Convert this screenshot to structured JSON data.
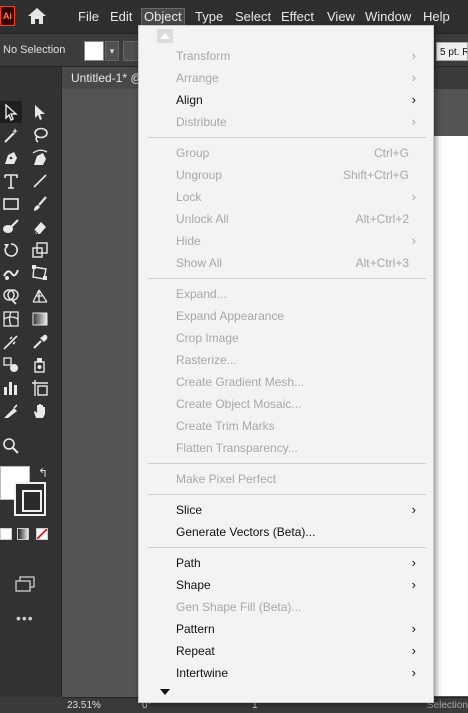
{
  "menubar": {
    "logo": "Ai",
    "items": [
      "File",
      "Edit",
      "Object",
      "Type",
      "Select",
      "Effect",
      "View",
      "Window",
      "Help"
    ]
  },
  "controlbar": {
    "selection_status": "No Selection",
    "stroke_weight": "5 pt. R"
  },
  "document": {
    "tab_title": "Untitled-1* @"
  },
  "statusbar": {
    "zoom": "23.51%",
    "rotation": "0°",
    "artboard": "1",
    "mode": "Selection"
  },
  "object_menu": {
    "items": [
      {
        "label": "Transform",
        "shortcut": "",
        "submenu": true,
        "enabled": false
      },
      {
        "label": "Arrange",
        "shortcut": "",
        "submenu": true,
        "enabled": false
      },
      {
        "label": "Align",
        "shortcut": "",
        "submenu": true,
        "enabled": true
      },
      {
        "label": "Distribute",
        "shortcut": "",
        "submenu": true,
        "enabled": false
      },
      {
        "label": "Group",
        "shortcut": "Ctrl+G",
        "submenu": false,
        "enabled": false
      },
      {
        "label": "Ungroup",
        "shortcut": "Shift+Ctrl+G",
        "submenu": false,
        "enabled": false
      },
      {
        "label": "Lock",
        "shortcut": "",
        "submenu": true,
        "enabled": false
      },
      {
        "label": "Unlock All",
        "shortcut": "Alt+Ctrl+2",
        "submenu": false,
        "enabled": false
      },
      {
        "label": "Hide",
        "shortcut": "",
        "submenu": true,
        "enabled": false
      },
      {
        "label": "Show All",
        "shortcut": "Alt+Ctrl+3",
        "submenu": false,
        "enabled": false
      },
      {
        "label": "Expand...",
        "shortcut": "",
        "submenu": false,
        "enabled": false
      },
      {
        "label": "Expand Appearance",
        "shortcut": "",
        "submenu": false,
        "enabled": false
      },
      {
        "label": "Crop Image",
        "shortcut": "",
        "submenu": false,
        "enabled": false
      },
      {
        "label": "Rasterize...",
        "shortcut": "",
        "submenu": false,
        "enabled": false
      },
      {
        "label": "Create Gradient Mesh...",
        "shortcut": "",
        "submenu": false,
        "enabled": false
      },
      {
        "label": "Create Object Mosaic...",
        "shortcut": "",
        "submenu": false,
        "enabled": false
      },
      {
        "label": "Create Trim Marks",
        "shortcut": "",
        "submenu": false,
        "enabled": false
      },
      {
        "label": "Flatten Transparency...",
        "shortcut": "",
        "submenu": false,
        "enabled": false
      },
      {
        "label": "Make Pixel Perfect",
        "shortcut": "",
        "submenu": false,
        "enabled": false
      },
      {
        "label": "Slice",
        "shortcut": "",
        "submenu": true,
        "enabled": true
      },
      {
        "label": "Generate Vectors (Beta)...",
        "shortcut": "",
        "submenu": false,
        "enabled": true
      },
      {
        "label": "Path",
        "shortcut": "",
        "submenu": true,
        "enabled": true
      },
      {
        "label": "Shape",
        "shortcut": "",
        "submenu": true,
        "enabled": true
      },
      {
        "label": "Gen Shape Fill (Beta)...",
        "shortcut": "",
        "submenu": false,
        "enabled": false
      },
      {
        "label": "Pattern",
        "shortcut": "",
        "submenu": true,
        "enabled": true
      },
      {
        "label": "Repeat",
        "shortcut": "",
        "submenu": true,
        "enabled": true
      },
      {
        "label": "Intertwine",
        "shortcut": "",
        "submenu": true,
        "enabled": true
      }
    ],
    "submenu_glyph": "›"
  },
  "tools": [
    "selection-tool",
    "direct-selection-tool",
    "magic-wand-tool",
    "lasso-tool",
    "pen-tool",
    "curvature-tool",
    "type-tool",
    "line-segment-tool",
    "rectangle-tool",
    "paintbrush-tool",
    "blob-brush-tool",
    "eraser-tool",
    "rotate-tool",
    "scale-tool",
    "warp-tool",
    "free-transform-tool",
    "shape-builder-tool",
    "perspective-grid-tool",
    "mesh-tool",
    "gradient-tool",
    "eyedropper-tool",
    "blend-tool",
    "symbol-sprayer-tool",
    "column-graph-tool",
    "artboard-tool",
    "slice-tool",
    "hand-tool",
    "zoom-tool"
  ]
}
